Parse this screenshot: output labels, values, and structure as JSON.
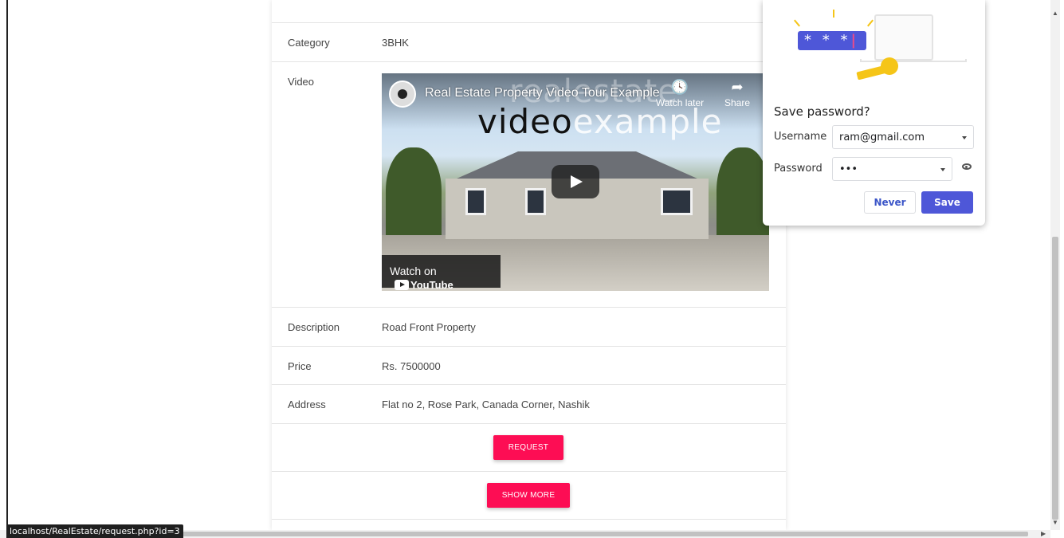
{
  "details": {
    "rows": [
      {
        "label": "Category",
        "value": "3BHK"
      },
      {
        "label": "Video",
        "value": ""
      },
      {
        "label": "Description",
        "value": "Road Front Property"
      },
      {
        "label": "Price",
        "value": "Rs. 7500000"
      },
      {
        "label": "Address",
        "value": "Flat no 2, Rose Park, Canada Corner, Nashik"
      }
    ]
  },
  "video": {
    "title": "Real Estate Property Video Tour Example",
    "overlay_word_1": "realestate",
    "overlay_word_2a": "video",
    "overlay_word_2b": "example",
    "watch_later_label": "Watch later",
    "share_label": "Share",
    "watch_on_label": "Watch on",
    "youtube_label": "YouTube"
  },
  "actions": {
    "request_label": "REQUEST",
    "show_more_label": "SHOW MORE",
    "accent_color": "#fd0d54"
  },
  "status_bar": {
    "url": "localhost/RealEstate/request.php?id=3"
  },
  "password_bubble": {
    "title": "Save password?",
    "username_label": "Username",
    "username_value": "ram@gmail.com",
    "password_label": "Password",
    "password_value": "•••",
    "never_label": "Never",
    "save_label": "Save",
    "illustration_text": "* * *",
    "accent_color": "#4e57d8"
  }
}
